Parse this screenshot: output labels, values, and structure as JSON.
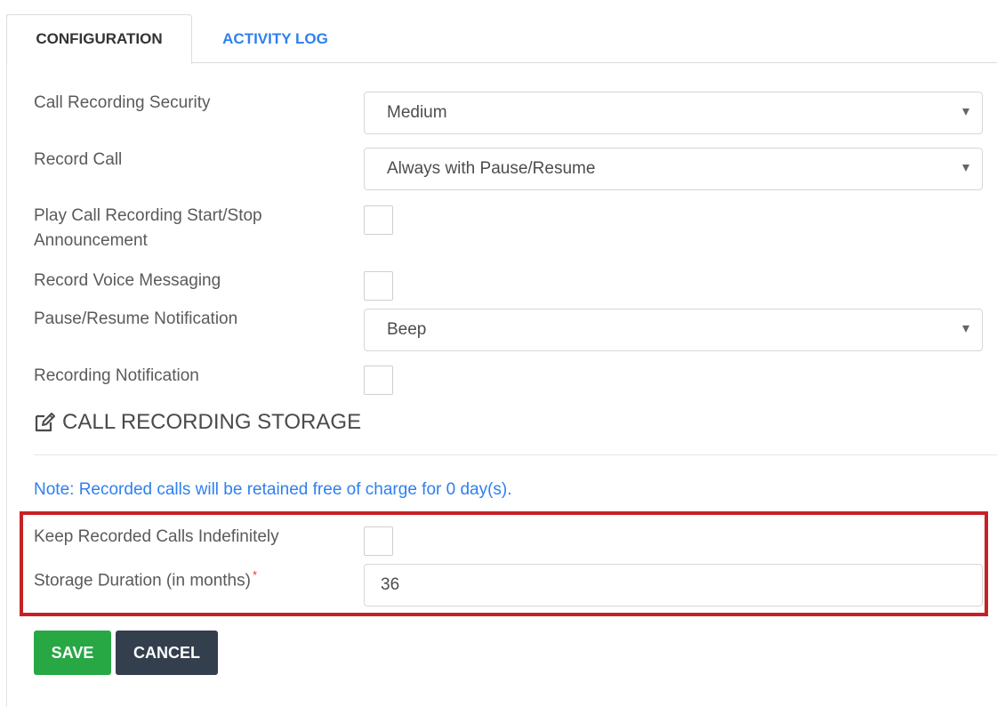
{
  "tabs": {
    "configuration": "CONFIGURATION",
    "activity_log": "ACTIVITY LOG"
  },
  "form": {
    "call_recording_security": {
      "label": "Call Recording Security",
      "value": "Medium"
    },
    "record_call": {
      "label": "Record Call",
      "value": "Always with Pause/Resume"
    },
    "play_announcement": {
      "label_line1": "Play Call Recording Start/Stop",
      "label_line2": "Announcement",
      "checked": false
    },
    "record_voice_messaging": {
      "label": "Record Voice Messaging",
      "checked": false
    },
    "pause_resume_notification": {
      "label": "Pause/Resume Notification",
      "value": "Beep"
    },
    "recording_notification": {
      "label": "Recording Notification",
      "checked": false
    }
  },
  "storage": {
    "section_title": "CALL RECORDING STORAGE",
    "note": "Note: Recorded calls will be retained free of charge for 0 day(s).",
    "keep_indefinitely": {
      "label": "Keep Recorded Calls Indefinitely",
      "checked": false
    },
    "storage_duration": {
      "label": "Storage Duration (in months)",
      "required_mark": "*",
      "value": "36"
    }
  },
  "buttons": {
    "save": "SAVE",
    "cancel": "CANCEL"
  },
  "colors": {
    "link_blue": "#2f80ed",
    "highlight_red": "#c62127",
    "save_green": "#28a745",
    "cancel_dark": "#343f4e"
  }
}
